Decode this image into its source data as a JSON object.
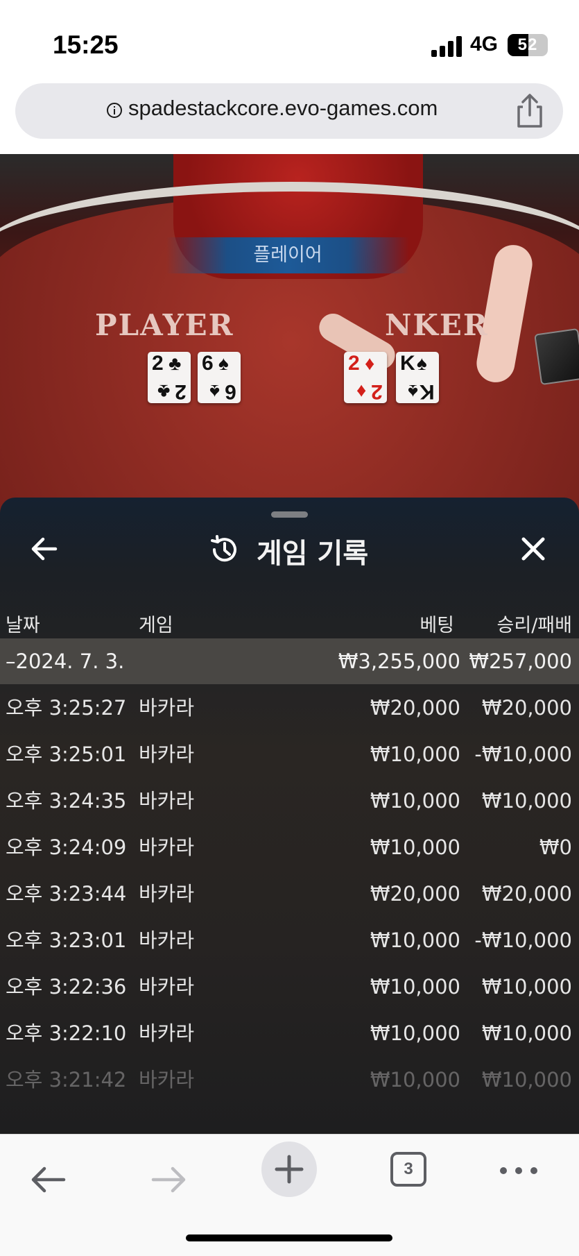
{
  "status_bar": {
    "time": "15:25",
    "network": "4G",
    "battery_level": "52",
    "battery_fraction": 0.52
  },
  "browser": {
    "url": "spadestackcore.evo-games.com",
    "tab_count": "3"
  },
  "game": {
    "banner": "플레이어",
    "player_label": "PLAYER",
    "banker_label": "NKER",
    "player_cards": [
      {
        "rank": "2",
        "suit": "♣",
        "color": "black"
      },
      {
        "rank": "6",
        "suit": "♠",
        "color": "black"
      }
    ],
    "banker_cards": [
      {
        "rank": "2",
        "suit": "♦",
        "color": "red"
      },
      {
        "rank": "K",
        "suit": "♠",
        "color": "black"
      }
    ]
  },
  "history": {
    "title": "게임 기록",
    "columns": {
      "date": "날짜",
      "game": "게임",
      "bet": "베팅",
      "result": "승리/패배"
    },
    "date_group": {
      "label": "–2024. 7. 3.",
      "total_bet": "₩3,255,000",
      "total_result": "₩257,000"
    },
    "rows": [
      {
        "time": "오후 3:25:27",
        "game": "바카라",
        "bet": "₩20,000",
        "result": "₩20,000"
      },
      {
        "time": "오후 3:25:01",
        "game": "바카라",
        "bet": "₩10,000",
        "result": "-₩10,000"
      },
      {
        "time": "오후 3:24:35",
        "game": "바카라",
        "bet": "₩10,000",
        "result": "₩10,000"
      },
      {
        "time": "오후 3:24:09",
        "game": "바카라",
        "bet": "₩10,000",
        "result": "₩0"
      },
      {
        "time": "오후 3:23:44",
        "game": "바카라",
        "bet": "₩20,000",
        "result": "₩20,000"
      },
      {
        "time": "오후 3:23:01",
        "game": "바카라",
        "bet": "₩10,000",
        "result": "-₩10,000"
      },
      {
        "time": "오후 3:22:36",
        "game": "바카라",
        "bet": "₩10,000",
        "result": "₩10,000"
      },
      {
        "time": "오후 3:22:10",
        "game": "바카라",
        "bet": "₩10,000",
        "result": "₩10,000"
      },
      {
        "time": "오후 3:21:42",
        "game": "바카라",
        "bet": "₩10,000",
        "result": "₩10,000"
      }
    ]
  },
  "icons": {
    "info": "info-icon",
    "share": "share-icon",
    "back": "arrow-left-icon",
    "close": "close-icon",
    "history": "history-icon",
    "forward": "arrow-right-icon",
    "new_tab": "plus-icon",
    "more": "more-icon"
  }
}
